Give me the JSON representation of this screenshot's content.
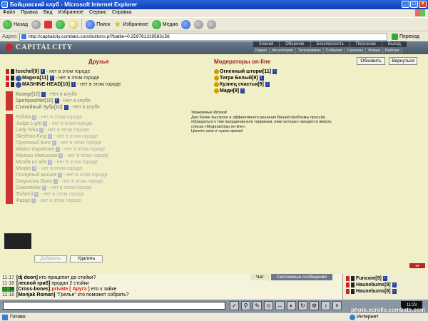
{
  "window": {
    "title": "Бойцовский клуб - Microsoft Internet Explorer"
  },
  "menu": [
    "Файл",
    "Правка",
    "Вид",
    "Избранное",
    "Сервис",
    "Справка"
  ],
  "toolbar": {
    "back": "Назад",
    "search": "Поиск",
    "favorites": "Избранное",
    "media": "Медиа"
  },
  "address": {
    "label": "Адрес:",
    "url": "http://capitalcity.combats.com/buttons.pl?battle=0.259761319583156",
    "go": "Переход"
  },
  "site": {
    "logo": "CAPITALCITY",
    "nav_top": [
      "Знания",
      "Общение",
      "Безопасность",
      "Персонаж",
      "Выход"
    ],
    "nav_bottom": [
      "Радио",
      "hto-история",
      "Телеграммы",
      "События",
      "Скроллы",
      "Форум",
      "Рейтинг"
    ]
  },
  "friends": {
    "title": "Друзья",
    "items": [
      {
        "nick": "tcechel",
        "level": "[9]",
        "loc": "- нет в этом городе",
        "state": "bold"
      },
      {
        "nick": "Magera",
        "level": "[11]",
        "loc": "- нет в этом городе",
        "state": "bold"
      },
      {
        "nick": "MASHINE-HEAD",
        "level": "[10]",
        "loc": "- нет в этом городе",
        "state": "bold"
      },
      {
        "nick": "Kosegr",
        "level": "[10]",
        "loc": "- Нет в клубе",
        "state": "gray"
      },
      {
        "nick": "Spetspashtet",
        "level": "[10]",
        "loc": "- Нет в клубе",
        "state": "gray"
      },
      {
        "nick": "Стихийный Зубр",
        "level": "[10]",
        "loc": "- Нет в клубе",
        "state": "gray"
      },
      {
        "nick": "Fufuka",
        "level": "",
        "loc": "- нет в этом городе",
        "state": "faded"
      },
      {
        "nick": "Judge Light",
        "level": "",
        "loc": "- нет в этом городе",
        "state": "faded"
      },
      {
        "nick": "Lady Nika",
        "level": "",
        "loc": "- нет в этом городе",
        "state": "faded"
      },
      {
        "nick": "Skeleton King",
        "level": "",
        "loc": "- нет в этом городе",
        "state": "faded"
      },
      {
        "nick": "Грустный Кот",
        "level": "",
        "loc": "- нет в этом городе",
        "state": "faded"
      },
      {
        "nick": "Майкл Корлеоне",
        "level": "",
        "loc": "- нет в этом городе",
        "state": "faded"
      },
      {
        "nick": "Малыш Малышок",
        "level": "",
        "loc": "- нет в этом городе",
        "state": "faded"
      },
      {
        "nick": "Мизда из ада",
        "level": "",
        "loc": "- нет в этом городе",
        "state": "faded"
      },
      {
        "nick": "Монро",
        "level": "",
        "loc": "- нет в этом городе",
        "state": "faded"
      },
      {
        "nick": "Полярный мишка",
        "level": "",
        "loc": "- нет в этом городе",
        "state": "faded"
      },
      {
        "nick": "Скорость Боли",
        "level": "",
        "loc": "- нет в этом городе",
        "state": "faded"
      },
      {
        "nick": "Соколёнок",
        "level": "",
        "loc": "- нет в этом городе",
        "state": "faded"
      },
      {
        "nick": "Тиджей",
        "level": "",
        "loc": "- нет в этом городе",
        "state": "faded"
      },
      {
        "nick": "Фазар",
        "level": "",
        "loc": "- нет в этом городе",
        "state": "faded"
      }
    ],
    "add_button": "Добавить",
    "delete_button": "Удалить"
  },
  "moderators": {
    "title": "Модераторы on-line",
    "items": [
      {
        "nick": "Огненный шторм",
        "level": "[11]"
      },
      {
        "nick": "Тигра Белый",
        "level": "[9]"
      },
      {
        "nick": "Кузнец счастья",
        "level": "[9]"
      },
      {
        "nick": "Мади",
        "level": "[9]"
      }
    ],
    "note": "Уважаемые Игроки!\nДля более быстрого и эффективного решения Вашей проблемы просьба обращаться к тем паладинам или тарманам, ники которых находятся вверху списка «Модераторы on-line».\nЦените свое и чужое время!",
    "refresh_button": "Обновить",
    "return_button": "Вернуться"
  },
  "chat": {
    "tabs": [
      "Чат",
      "Системные сообщения"
    ],
    "lines": [
      {
        "time": "11:17",
        "nick": "[dj doon]",
        "text": " кто прицепит до стойки?",
        "priv": "",
        "hl": false
      },
      {
        "time": "11:18",
        "nick": "[лесной гриб]",
        "text": " продан 2 стойки",
        "priv": "",
        "hl": false
      },
      {
        "time": "11:18",
        "nick": "[Cross-bones]",
        "text": " ето к зайке",
        "priv": "private [ Аругэ ]",
        "hl": true
      },
      {
        "time": "11:18",
        "nick": "[Monjak Roman]",
        "text": " \"Грелье\" кто поможет собрать?",
        "priv": "",
        "hl": false
      }
    ],
    "online": [
      {
        "nick": "Funcom",
        "level": "[9]"
      },
      {
        "nick": "Haunebums",
        "level": "[8]"
      },
      {
        "nick": "Haunebums",
        "level": "[8]"
      }
    ],
    "clock": "11:23"
  },
  "status": {
    "text": "Готово",
    "zone": "Интернет"
  },
  "watermark": "photo.scrolls.combats.com"
}
